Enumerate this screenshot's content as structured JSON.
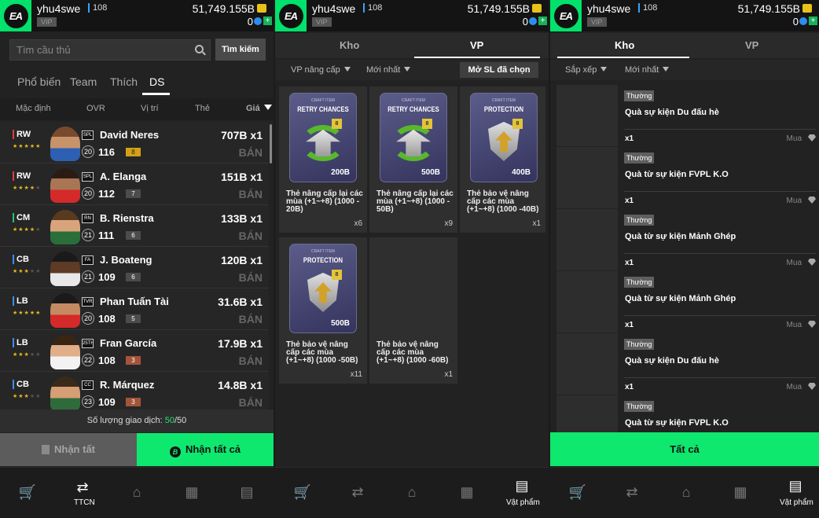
{
  "header": {
    "username": "yhu4swe",
    "level": "108",
    "vip": "VIP",
    "coins": "51,749.155B",
    "points": "0"
  },
  "panel1": {
    "search_placeholder": "Tìm cầu thủ",
    "search_button": "Tìm kiếm",
    "tabs": [
      "Phổ biến",
      "Team",
      "Thích",
      "DS"
    ],
    "active_tab": "DS",
    "sort_columns": [
      "Mặc định",
      "OVR",
      "Vị trí",
      "Thẻ",
      "Giá"
    ],
    "players": [
      {
        "pos": "RW",
        "club": "SPL",
        "name": "David Neres",
        "grade": "20",
        "ovr": "116",
        "upgrade": "8",
        "price": "707B",
        "qty": "x1",
        "status": "BÁN"
      },
      {
        "pos": "RW",
        "club": "SPL",
        "name": "A. Elanga",
        "grade": "20",
        "ovr": "112",
        "upgrade": "7",
        "price": "151B",
        "qty": "x1",
        "status": "BÁN"
      },
      {
        "pos": "CM",
        "club": "RN",
        "name": "B. Rienstra",
        "grade": "21",
        "ovr": "111",
        "upgrade": "6",
        "price": "133B",
        "qty": "x1",
        "status": "BÁN"
      },
      {
        "pos": "CB",
        "club": "FA",
        "name": "J. Boateng",
        "grade": "21",
        "ovr": "109",
        "upgrade": "6",
        "price": "120B",
        "qty": "x1",
        "status": "BÁN"
      },
      {
        "pos": "LB",
        "club": "TVR",
        "name": "Phan Tuấn Tài",
        "grade": "20",
        "ovr": "108",
        "upgrade": "5",
        "price": "31.6B",
        "qty": "x1",
        "status": "BÁN"
      },
      {
        "pos": "LB",
        "club": "25TH",
        "name": "Fran García",
        "grade": "22",
        "ovr": "108",
        "upgrade": "3",
        "price": "17.9B",
        "qty": "x1",
        "status": "BÁN"
      },
      {
        "pos": "CB",
        "club": "CC",
        "name": "R. Márquez",
        "grade": "23",
        "ovr": "109",
        "upgrade": "3",
        "price": "14.8B",
        "qty": "x1",
        "status": "BÁN"
      }
    ],
    "trade_label": "Số lượng giao dịch:",
    "trade_count": "50",
    "trade_max": "/50",
    "btn_receive": "Nhận tất",
    "btn_receive_all": "Nhận tất cả",
    "nav_label": "TTCN"
  },
  "panel2": {
    "tabs": [
      "Kho",
      "VP"
    ],
    "active_tab": "VP",
    "filters": [
      "VP nâng cấp",
      "Mới nhất"
    ],
    "open_btn": "Mở SL đã chọn",
    "cards": [
      {
        "mini": "CRAFT ITEM",
        "pack_title": "RETRY CHANCES",
        "amount": "200B",
        "title": "Thẻ nâng cấp lại các mùa (+1~+8) (1000 - 20B)",
        "qty": "x6"
      },
      {
        "mini": "CRAFT ITEM",
        "pack_title": "RETRY CHANCES",
        "amount": "500B",
        "title": "Thẻ nâng cấp lại các mùa (+1~+8) (1000 - 50B)",
        "qty": "x9"
      },
      {
        "mini": "CRAFT ITEM",
        "pack_title": "PROTECTION",
        "amount": "400B",
        "title": "Thẻ bảo vệ nâng cấp các mùa (+1~+8) (1000 -40B)",
        "qty": "x1"
      },
      {
        "mini": "CRAFT ITEM",
        "pack_title": "PROTECTION",
        "amount": "500B",
        "title": "Thẻ bảo vệ nâng cấp các mùa (+1~+8) (1000 -50B)",
        "qty": "x11"
      },
      {
        "title": "Thẻ bảo vệ nâng cấp các mùa (+1~+8) (1000 -60B)",
        "qty": "x1"
      }
    ],
    "nav_label": "Vật phẩm"
  },
  "panel3": {
    "tabs": [
      "Kho",
      "VP"
    ],
    "active_tab": "Kho",
    "filters": [
      "Sắp xếp",
      "Mới nhất"
    ],
    "items": [
      {
        "tag": "Thường",
        "name": "Quà sự kiện Du đấu hè",
        "qty": "x1",
        "buy": "Mua"
      },
      {
        "tag": "Thường",
        "name": "Quà từ sự kiện FVPL K.O",
        "qty": "x1",
        "buy": "Mua"
      },
      {
        "tag": "Thường",
        "name": "Quà từ sự kiện Mảnh Ghép",
        "qty": "x1",
        "buy": "Mua"
      },
      {
        "tag": "Thường",
        "name": "Quà từ sự kiện Mảnh Ghép",
        "qty": "x1",
        "buy": "Mua"
      },
      {
        "tag": "Thường",
        "name": "Quà sự kiện Du đấu hè",
        "qty": "x1",
        "buy": "Mua"
      },
      {
        "tag": "Thường",
        "name": "Quà từ sự kiện FVPL K.O",
        "qty": "",
        "buy": ""
      }
    ],
    "btn_all": "Tất cả",
    "nav_label": "Vật phẩm"
  },
  "colors": {
    "accent": "#0ee86f",
    "bg": "#222222"
  },
  "icons": [
    "ea-logo",
    "coin-icon",
    "bp-icon",
    "plus-icon",
    "search-icon",
    "cart-icon",
    "transfer-icon",
    "home-icon",
    "squad-icon",
    "inventory-icon",
    "gem-icon"
  ]
}
